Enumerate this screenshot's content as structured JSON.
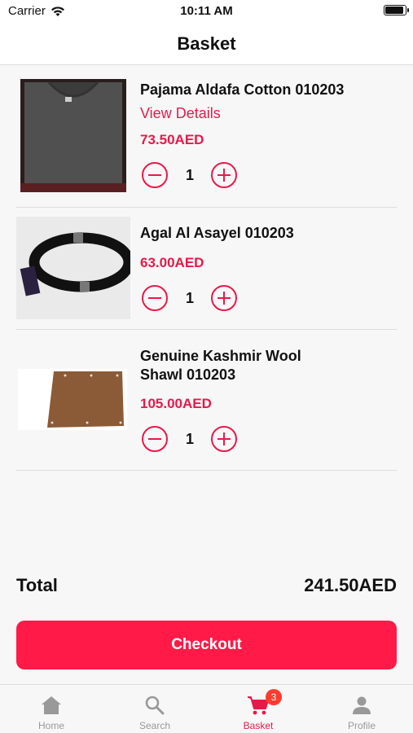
{
  "status_bar": {
    "carrier": "Carrier",
    "time": "10:11 AM"
  },
  "header": {
    "title": "Basket"
  },
  "items": [
    {
      "name": "Pajama Aldafa Cotton 010203",
      "details_link": "View Details",
      "price": "73.50AED",
      "quantity": "1"
    },
    {
      "name": "Agal Al Asayel 010203",
      "price": "63.00AED",
      "quantity": "1"
    },
    {
      "name_line1": "Genuine Kashmir Wool",
      "name_line2": "Shawl 010203",
      "price": "105.00AED",
      "quantity": "1"
    }
  ],
  "total": {
    "label": "Total",
    "value": "241.50AED"
  },
  "checkout_label": "Checkout",
  "tabs": [
    {
      "label": "Home",
      "icon": "home-icon"
    },
    {
      "label": "Search",
      "icon": "search-icon"
    },
    {
      "label": "Basket",
      "icon": "cart-icon",
      "badge": "3"
    },
    {
      "label": "Profile",
      "icon": "person-icon"
    }
  ],
  "colors": {
    "accent": "#e8194a",
    "checkout": "#ff1a47",
    "badge": "#ff3b30"
  }
}
